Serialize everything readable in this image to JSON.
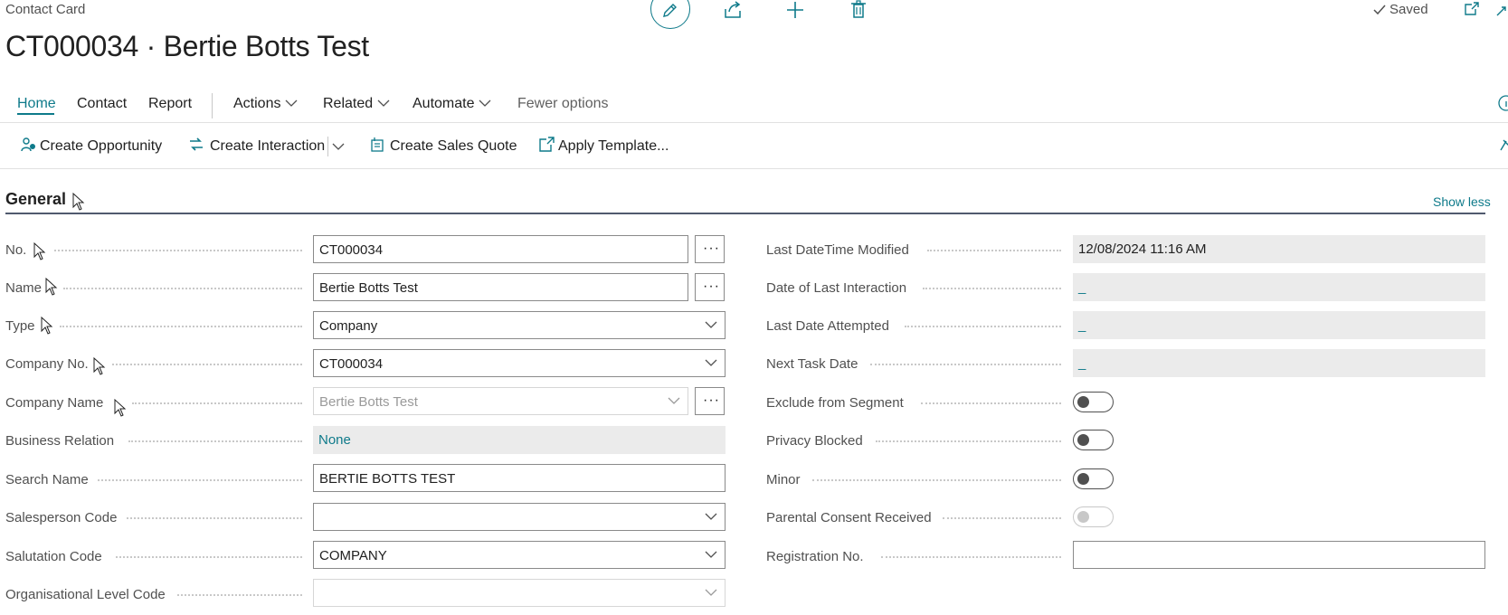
{
  "header": {
    "breadcrumb": "Contact Card",
    "title": "CT000034 · Bertie Botts Test",
    "status": "Saved"
  },
  "icons": [
    "edit-icon",
    "share-icon",
    "add-icon",
    "delete-icon",
    "open-new-window-icon",
    "expand-icon",
    "info-icon",
    "pin-icon"
  ],
  "tabs": {
    "home": "Home",
    "contact": "Contact",
    "report": "Report",
    "actions": "Actions",
    "related": "Related",
    "automate": "Automate",
    "fewer": "Fewer options"
  },
  "actions": {
    "create_opportunity": "Create Opportunity",
    "create_interaction": "Create Interaction",
    "create_sales_quote": "Create Sales Quote",
    "apply_template": "Apply Template..."
  },
  "section": {
    "title": "General",
    "toggle_label": "Show less"
  },
  "left_fields": {
    "no": {
      "label": "No.",
      "value": "CT000034"
    },
    "name": {
      "label": "Name",
      "value": "Bertie Botts Test"
    },
    "type": {
      "label": "Type",
      "value": "Company"
    },
    "company_no": {
      "label": "Company No.",
      "value": "CT000034"
    },
    "company_name": {
      "label": "Company Name",
      "value": "Bertie Botts Test"
    },
    "business_relation": {
      "label": "Business Relation",
      "value": "None"
    },
    "search_name": {
      "label": "Search Name",
      "value": "BERTIE BOTTS TEST"
    },
    "salesperson_code": {
      "label": "Salesperson Code",
      "value": ""
    },
    "salutation_code": {
      "label": "Salutation Code",
      "value": "COMPANY"
    },
    "org_level_code": {
      "label": "Organisational Level Code",
      "value": ""
    }
  },
  "right_fields": {
    "last_modified": {
      "label": "Last DateTime Modified",
      "value": "12/08/2024 11:16 AM"
    },
    "last_interaction": {
      "label": "Date of Last Interaction",
      "value": "_"
    },
    "last_attempted": {
      "label": "Last Date Attempted",
      "value": "_"
    },
    "next_task": {
      "label": "Next Task Date",
      "value": "_"
    },
    "exclude_segment": {
      "label": "Exclude from Segment",
      "value": false
    },
    "privacy_blocked": {
      "label": "Privacy Blocked",
      "value": false
    },
    "minor": {
      "label": "Minor",
      "value": false
    },
    "parental_consent": {
      "label": "Parental Consent Received",
      "value": false
    },
    "registration_no": {
      "label": "Registration No.",
      "value": ""
    }
  },
  "colors": {
    "accent": "#0e7a8a",
    "readonly_bg": "#ebebeb"
  }
}
